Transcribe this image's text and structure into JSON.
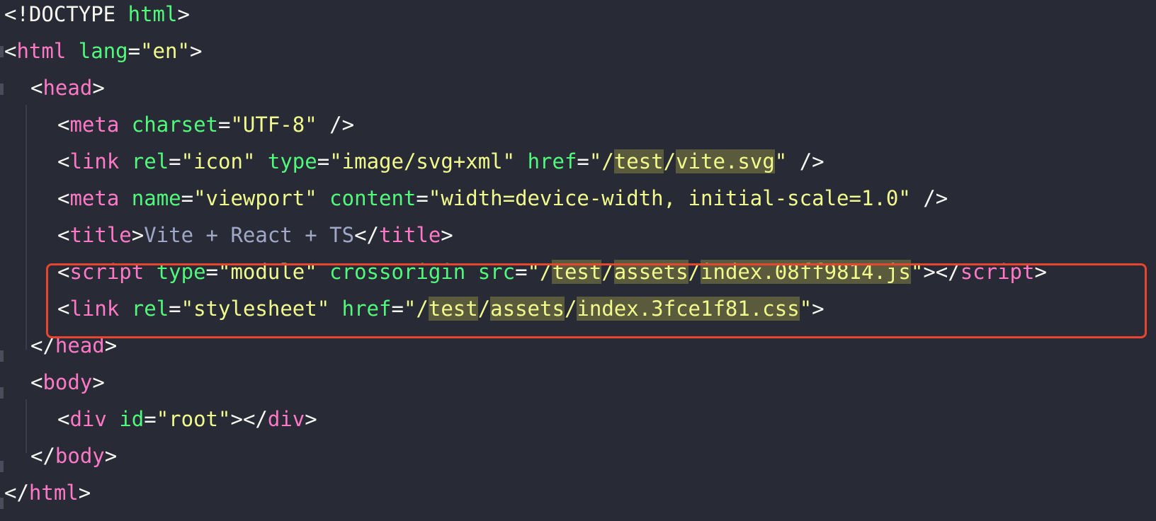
{
  "editor": {
    "lines": [
      [
        {
          "text": "<!DOCTYPE ",
          "cls": "t"
        },
        {
          "text": "html",
          "cls": "attr"
        },
        {
          "text": ">",
          "cls": "t"
        }
      ],
      [
        {
          "text": "<",
          "cls": "t"
        },
        {
          "text": "html",
          "cls": "tag"
        },
        {
          "text": " ",
          "cls": "t"
        },
        {
          "text": "lang",
          "cls": "attr"
        },
        {
          "text": "=",
          "cls": "t"
        },
        {
          "text": "\"en\"",
          "cls": "str"
        },
        {
          "text": ">",
          "cls": "t"
        }
      ],
      [
        {
          "text": "<",
          "cls": "t"
        },
        {
          "text": "head",
          "cls": "tag"
        },
        {
          "text": ">",
          "cls": "t"
        }
      ],
      [
        {
          "text": "<",
          "cls": "t"
        },
        {
          "text": "meta",
          "cls": "tag"
        },
        {
          "text": " ",
          "cls": "t"
        },
        {
          "text": "charset",
          "cls": "attr"
        },
        {
          "text": "=",
          "cls": "t"
        },
        {
          "text": "\"UTF-8\"",
          "cls": "str"
        },
        {
          "text": " />",
          "cls": "t"
        }
      ],
      [
        {
          "text": "<",
          "cls": "t"
        },
        {
          "text": "link",
          "cls": "tag"
        },
        {
          "text": " ",
          "cls": "t"
        },
        {
          "text": "rel",
          "cls": "attr"
        },
        {
          "text": "=",
          "cls": "t"
        },
        {
          "text": "\"icon\"",
          "cls": "str"
        },
        {
          "text": " ",
          "cls": "t"
        },
        {
          "text": "type",
          "cls": "attr"
        },
        {
          "text": "=",
          "cls": "t"
        },
        {
          "text": "\"image/svg+xml\"",
          "cls": "str"
        },
        {
          "text": " ",
          "cls": "t"
        },
        {
          "text": "href",
          "cls": "attr"
        },
        {
          "text": "=",
          "cls": "t"
        },
        {
          "text": "\"/",
          "cls": "str"
        },
        {
          "text": "test",
          "cls": "str hl"
        },
        {
          "text": "/",
          "cls": "str"
        },
        {
          "text": "vite.svg",
          "cls": "str hl"
        },
        {
          "text": "\"",
          "cls": "str"
        },
        {
          "text": " />",
          "cls": "t"
        }
      ],
      [
        {
          "text": "<",
          "cls": "t"
        },
        {
          "text": "meta",
          "cls": "tag"
        },
        {
          "text": " ",
          "cls": "t"
        },
        {
          "text": "name",
          "cls": "attr"
        },
        {
          "text": "=",
          "cls": "t"
        },
        {
          "text": "\"viewport\"",
          "cls": "str"
        },
        {
          "text": " ",
          "cls": "t"
        },
        {
          "text": "content",
          "cls": "attr"
        },
        {
          "text": "=",
          "cls": "t"
        },
        {
          "text": "\"width=device-width, initial-scale=1.0\"",
          "cls": "str"
        },
        {
          "text": " />",
          "cls": "t"
        }
      ],
      [
        {
          "text": "<",
          "cls": "t"
        },
        {
          "text": "title",
          "cls": "tag"
        },
        {
          "text": ">",
          "cls": "t"
        },
        {
          "text": "Vite + React + TS",
          "cls": "txt"
        },
        {
          "text": "</",
          "cls": "t"
        },
        {
          "text": "title",
          "cls": "tag"
        },
        {
          "text": ">",
          "cls": "t"
        }
      ],
      [
        {
          "text": "<",
          "cls": "t"
        },
        {
          "text": "script",
          "cls": "tag"
        },
        {
          "text": " ",
          "cls": "t"
        },
        {
          "text": "type",
          "cls": "attr"
        },
        {
          "text": "=",
          "cls": "t"
        },
        {
          "text": "\"module\"",
          "cls": "str"
        },
        {
          "text": " ",
          "cls": "t"
        },
        {
          "text": "crossorigin",
          "cls": "attr"
        },
        {
          "text": " ",
          "cls": "t"
        },
        {
          "text": "src",
          "cls": "attr"
        },
        {
          "text": "=",
          "cls": "t"
        },
        {
          "text": "\"/",
          "cls": "str"
        },
        {
          "text": "test",
          "cls": "str hl"
        },
        {
          "text": "/",
          "cls": "str"
        },
        {
          "text": "assets",
          "cls": "str hl"
        },
        {
          "text": "/",
          "cls": "str"
        },
        {
          "text": "index.08ff9814.js",
          "cls": "str hl"
        },
        {
          "text": "\"",
          "cls": "str"
        },
        {
          "text": "></",
          "cls": "t"
        },
        {
          "text": "script",
          "cls": "tag"
        },
        {
          "text": ">",
          "cls": "t"
        }
      ],
      [
        {
          "text": "<",
          "cls": "t"
        },
        {
          "text": "link",
          "cls": "tag"
        },
        {
          "text": " ",
          "cls": "t"
        },
        {
          "text": "rel",
          "cls": "attr"
        },
        {
          "text": "=",
          "cls": "t"
        },
        {
          "text": "\"stylesheet\"",
          "cls": "str"
        },
        {
          "text": " ",
          "cls": "t"
        },
        {
          "text": "href",
          "cls": "attr"
        },
        {
          "text": "=",
          "cls": "t"
        },
        {
          "text": "\"/",
          "cls": "str"
        },
        {
          "text": "test",
          "cls": "str hl"
        },
        {
          "text": "/",
          "cls": "str"
        },
        {
          "text": "assets",
          "cls": "str hl"
        },
        {
          "text": "/",
          "cls": "str"
        },
        {
          "text": "index.3fce1f81.css",
          "cls": "str hl"
        },
        {
          "text": "\"",
          "cls": "str"
        },
        {
          "text": ">",
          "cls": "t"
        }
      ],
      [
        {
          "text": "</",
          "cls": "t"
        },
        {
          "text": "head",
          "cls": "tag"
        },
        {
          "text": ">",
          "cls": "t"
        }
      ],
      [
        {
          "text": "<",
          "cls": "t"
        },
        {
          "text": "body",
          "cls": "tag"
        },
        {
          "text": ">",
          "cls": "t"
        }
      ],
      [
        {
          "text": "<",
          "cls": "t"
        },
        {
          "text": "div",
          "cls": "tag"
        },
        {
          "text": " ",
          "cls": "t"
        },
        {
          "text": "id",
          "cls": "attr"
        },
        {
          "text": "=",
          "cls": "t"
        },
        {
          "text": "\"root\"",
          "cls": "str"
        },
        {
          "text": "></",
          "cls": "t"
        },
        {
          "text": "div",
          "cls": "tag"
        },
        {
          "text": ">",
          "cls": "t"
        }
      ],
      [
        {
          "text": "</",
          "cls": "t"
        },
        {
          "text": "body",
          "cls": "tag"
        },
        {
          "text": ">",
          "cls": "t"
        }
      ],
      [
        {
          "text": "</",
          "cls": "t"
        },
        {
          "text": "html",
          "cls": "tag"
        },
        {
          "text": ">",
          "cls": "t"
        }
      ]
    ]
  }
}
